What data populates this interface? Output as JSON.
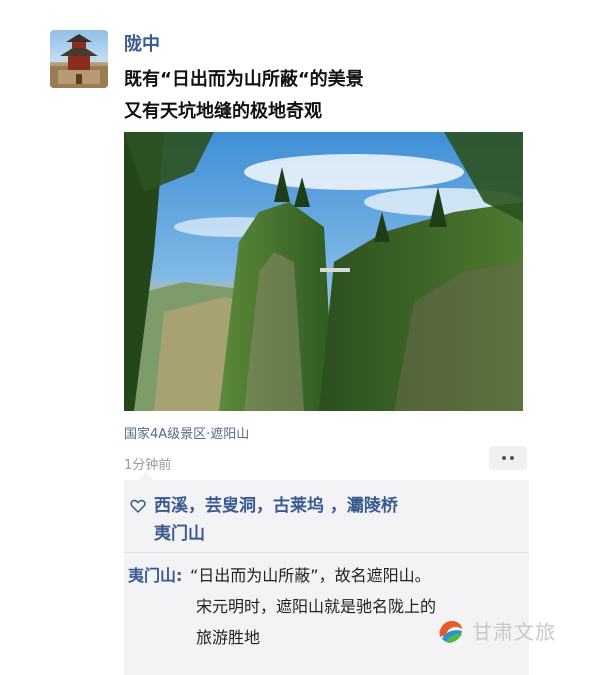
{
  "post": {
    "author": "陇中",
    "lines": [
      "既有“日出而为山所蔽“的美景",
      "又有天坑地缝的极地奇观"
    ],
    "location": "国家4A级景区·遮阳山",
    "time": "1分钟前"
  },
  "likes": {
    "names": [
      "西溪，",
      "芸叟洞，",
      "古莱坞 ，",
      "灞陵桥",
      "夷门山"
    ]
  },
  "comment": {
    "author": "夷门山:",
    "line1": "“日出而为山所蔽”，故名遮阳山。",
    "line2": "宋元明时，遮阳山就是驰名陇上的",
    "line3": "旅游胜地"
  },
  "watermark": {
    "text": "甘肃文旅"
  },
  "colors": {
    "name_blue": "#3a5a8f",
    "panel_bg": "#f3f3f5"
  }
}
